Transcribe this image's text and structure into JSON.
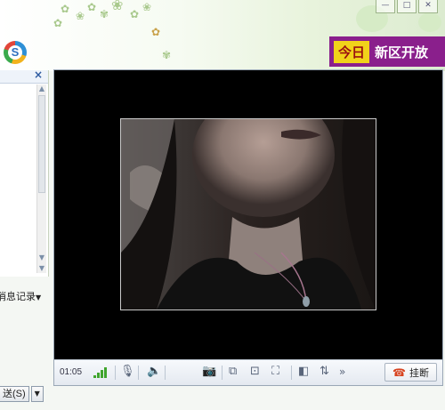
{
  "banner": {
    "ad_highlight": "今日",
    "ad_text": "新区开放"
  },
  "window_controls": {
    "minimize_icon": "minimize-icon",
    "maximize_icon": "maximize-icon",
    "close_icon": "close-icon"
  },
  "side_panel": {
    "close_label": "×",
    "message_history_label": "消息记录",
    "send_label": "送(S)"
  },
  "video_call": {
    "elapsed_time": "01:05",
    "hangup_label": "挂断",
    "more_label": "»"
  },
  "colors": {
    "ad_background": "#8a1f8c",
    "ad_badge": "#f1d21a",
    "signal_bars": "#3fa52d"
  }
}
